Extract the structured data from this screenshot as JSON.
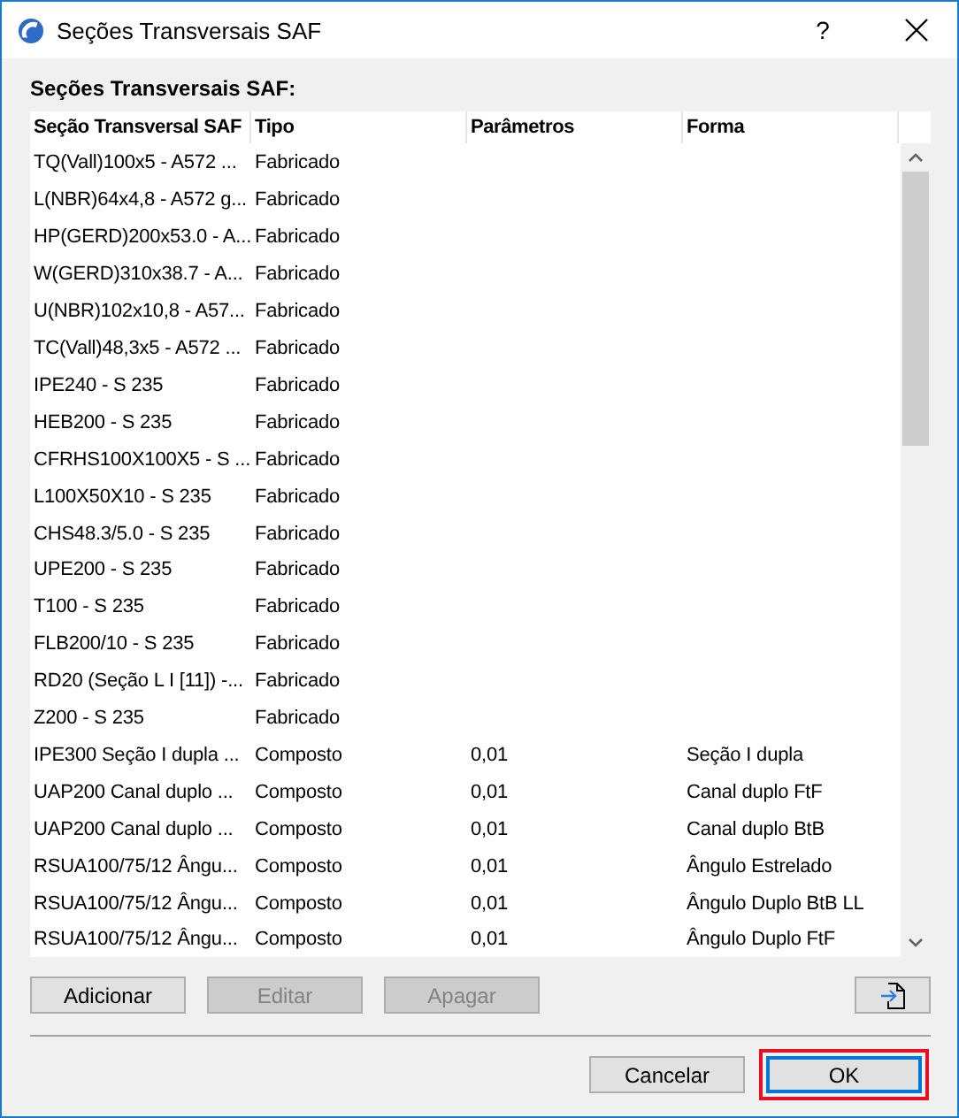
{
  "window": {
    "title": "Seções Transversais SAF",
    "help": "?"
  },
  "list_label": "Seções Transversais SAF:",
  "table": {
    "columns": [
      "Seção Transversal SAF",
      "Tipo",
      "Parâmetros",
      "Forma"
    ],
    "rows": [
      [
        "TQ(Vall)100x5 - A572 ...",
        "Fabricado",
        "",
        ""
      ],
      [
        "L(NBR)64x4,8 - A572 g...",
        "Fabricado",
        "",
        ""
      ],
      [
        "HP(GERD)200x53.0 - A...",
        "Fabricado",
        "",
        ""
      ],
      [
        "W(GERD)310x38.7 - A...",
        "Fabricado",
        "",
        ""
      ],
      [
        "U(NBR)102x10,8 - A57...",
        "Fabricado",
        "",
        ""
      ],
      [
        "TC(Vall)48,3x5 - A572 ...",
        "Fabricado",
        "",
        ""
      ],
      [
        "IPE240 - S 235",
        "Fabricado",
        "",
        ""
      ],
      [
        "HEB200 - S 235",
        "Fabricado",
        "",
        ""
      ],
      [
        "CFRHS100X100X5 - S ...",
        "Fabricado",
        "",
        ""
      ],
      [
        "L100X50X10 - S 235",
        "Fabricado",
        "",
        ""
      ],
      [
        "CHS48.3/5.0 - S 235",
        "Fabricado",
        "",
        ""
      ],
      [
        "UPE200 - S 235",
        "Fabricado",
        "",
        ""
      ],
      [
        "T100 - S 235",
        "Fabricado",
        "",
        ""
      ],
      [
        "FLB200/10 - S 235",
        "Fabricado",
        "",
        ""
      ],
      [
        "RD20 (Seção L I [11]) -...",
        "Fabricado",
        "",
        ""
      ],
      [
        "Z200 - S 235",
        "Fabricado",
        "",
        ""
      ],
      [
        "IPE300 Seção I dupla ...",
        "Composto",
        "0,01",
        "Seção I dupla"
      ],
      [
        "UAP200 Canal duplo ...",
        "Composto",
        "0,01",
        "Canal duplo FtF"
      ],
      [
        "UAP200 Canal duplo ...",
        "Composto",
        "0,01",
        "Canal duplo BtB"
      ],
      [
        "RSUA100/75/12 Ângu...",
        "Composto",
        "0,01",
        "Ângulo Estrelado"
      ],
      [
        "RSUA100/75/12 Ângu...",
        "Composto",
        "0,01",
        "Ângulo Duplo BtB LL"
      ],
      [
        "RSUA100/75/12 Ângu...",
        "Composto",
        "0,01",
        "Ângulo Duplo  FtF"
      ]
    ]
  },
  "actions": [
    {
      "label": "Adicionar",
      "disabled": false
    },
    {
      "label": "Editar",
      "disabled": true
    },
    {
      "label": "Apagar",
      "disabled": true
    }
  ],
  "footer": [
    {
      "label": "Cancelar",
      "default": false,
      "highlighted": false
    },
    {
      "label": "OK",
      "default": true,
      "highlighted": true
    }
  ]
}
